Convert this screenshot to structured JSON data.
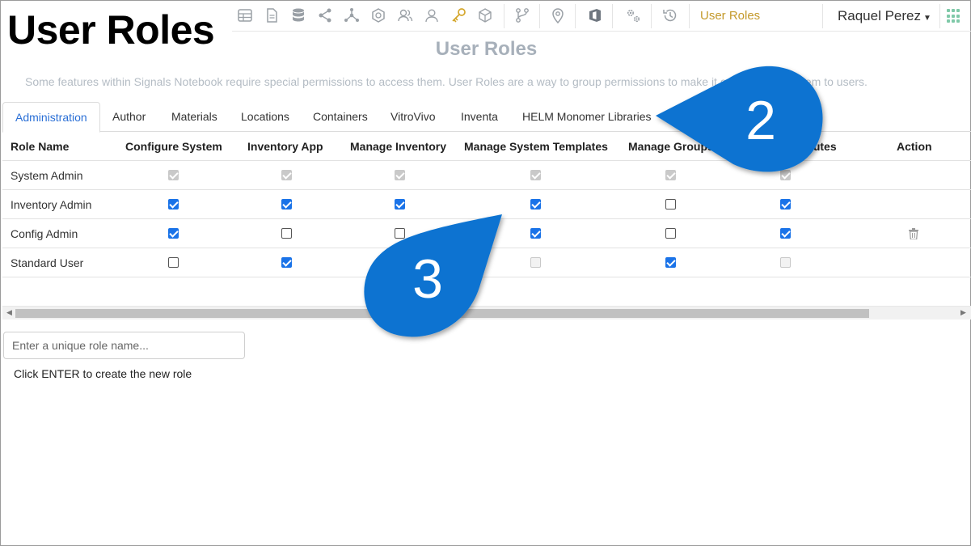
{
  "overlay_title": "User Roles",
  "toolbar": {
    "icons": [
      "table-icon",
      "document-icon",
      "database-icon",
      "share-icon",
      "network-icon",
      "hexagon-icon",
      "users-icon",
      "user-icon",
      "key-icon",
      "cube-icon",
      "workflow-icon",
      "location-pin-icon",
      "office-icon",
      "settings-gears-icon",
      "history-icon"
    ],
    "active_icon": "key-icon",
    "accent_color": "#c49a2c",
    "breadcrumb": "User Roles",
    "user_name": "Raquel Perez"
  },
  "page": {
    "heading": "User Roles",
    "intro": "Some features within Signals Notebook require special permissions to access them. User Roles are a way to group permissions to make it easy to assign them to users."
  },
  "tabs": [
    {
      "label": "Administration",
      "active": true
    },
    {
      "label": "Author"
    },
    {
      "label": "Materials"
    },
    {
      "label": "Locations"
    },
    {
      "label": "Containers"
    },
    {
      "label": "VitroVivo"
    },
    {
      "label": "Inventa"
    },
    {
      "label": "HELM Monomer Libraries"
    }
  ],
  "table": {
    "columns": [
      "Role Name",
      "Configure System",
      "Inventory App",
      "Manage Inventory",
      "Manage System Templates",
      "Manage Groups",
      "Manage Attributes",
      "Action"
    ],
    "rows": [
      {
        "name": "System Admin",
        "cells": [
          {
            "checked": true,
            "disabled": true
          },
          {
            "checked": true,
            "disabled": true
          },
          {
            "checked": true,
            "disabled": true
          },
          {
            "checked": true,
            "disabled": true
          },
          {
            "checked": true,
            "disabled": true
          },
          {
            "checked": true,
            "disabled": true
          }
        ],
        "deletable": false
      },
      {
        "name": "Inventory Admin",
        "cells": [
          {
            "checked": true
          },
          {
            "checked": true
          },
          {
            "checked": true
          },
          {
            "checked": true
          },
          {
            "checked": false
          },
          {
            "checked": true
          }
        ],
        "deletable": false
      },
      {
        "name": "Config Admin",
        "cells": [
          {
            "checked": true
          },
          {
            "checked": false
          },
          {
            "checked": false
          },
          {
            "checked": true
          },
          {
            "checked": false
          },
          {
            "checked": true
          }
        ],
        "deletable": true
      },
      {
        "name": "Standard User",
        "cells": [
          {
            "checked": false
          },
          {
            "checked": true
          },
          {
            "checked": false
          },
          {
            "checked": false,
            "disabled": true
          },
          {
            "checked": true
          },
          {
            "checked": false,
            "disabled": true
          }
        ],
        "deletable": false
      }
    ]
  },
  "new_role": {
    "placeholder": "Enter a unique role name...",
    "hint": "Click ENTER to create the new role"
  },
  "callouts": [
    {
      "number": "2",
      "color": "#0a73d1"
    },
    {
      "number": "3",
      "color": "#0a73d1"
    }
  ]
}
